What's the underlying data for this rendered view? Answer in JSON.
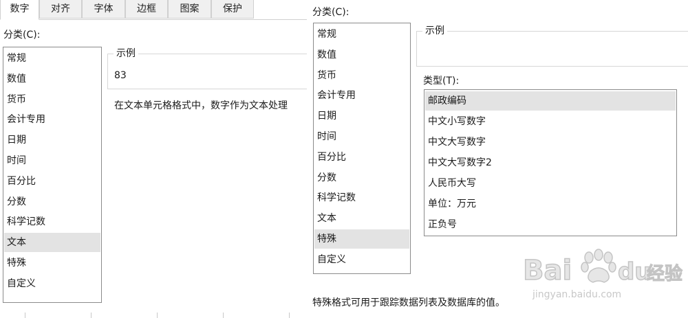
{
  "left": {
    "tabs": [
      {
        "label": "数字",
        "active": true
      },
      {
        "label": "对齐",
        "active": false
      },
      {
        "label": "字体",
        "active": false
      },
      {
        "label": "边框",
        "active": false
      },
      {
        "label": "图案",
        "active": false
      },
      {
        "label": "保护",
        "active": false
      }
    ],
    "category_label": "分类(C):",
    "categories": [
      "常规",
      "数值",
      "货币",
      "会计专用",
      "日期",
      "时间",
      "百分比",
      "分数",
      "科学记数",
      "文本",
      "特殊",
      "自定义"
    ],
    "selected_category": "文本",
    "sample_legend": "示例",
    "sample_value": "83",
    "description": "在文本单元格格式中，数字作为文本处理"
  },
  "right": {
    "category_label": "分类(C):",
    "categories": [
      "常规",
      "数值",
      "货币",
      "会计专用",
      "日期",
      "时间",
      "百分比",
      "分数",
      "科学记数",
      "文本",
      "特殊",
      "自定义"
    ],
    "selected_category": "特殊",
    "sample_legend": "示例",
    "type_label": "类型(T):",
    "types": [
      "邮政编码",
      "中文小写数字",
      "中文大写数字",
      "中文大写数字2",
      "人民币大写",
      "单位：万元",
      "正负号"
    ],
    "selected_type": "邮政编码",
    "description": "特殊格式可用于跟踪数据列表及数据库的值。"
  },
  "watermark": {
    "brand_text": "Bai",
    "brand_text2": "du",
    "brand_cn": "经验",
    "url": "jingyan.baidu.com"
  }
}
